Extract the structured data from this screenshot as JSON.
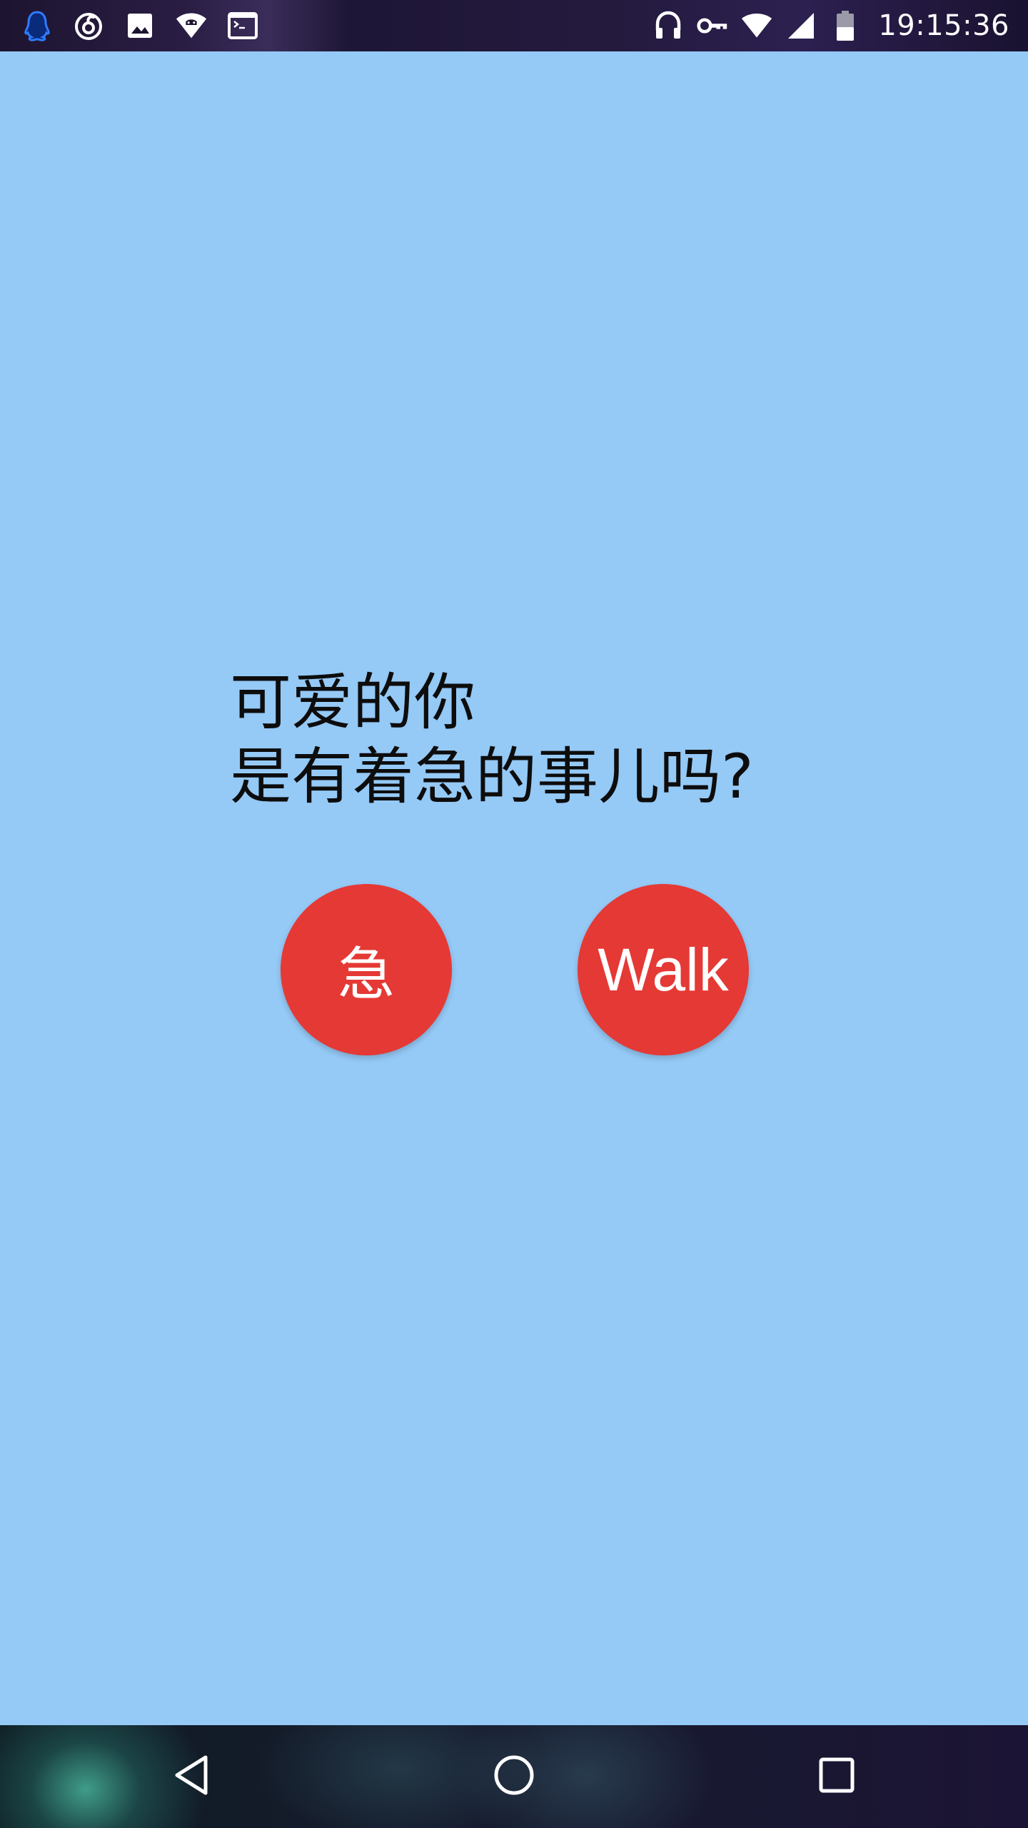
{
  "status_bar": {
    "time": "19:15:36",
    "left_icons": [
      "qq-penguin-icon",
      "netease-music-icon",
      "image-icon",
      "wifi-android-icon",
      "terminal-icon"
    ],
    "right_icons": [
      "headphones-icon",
      "vpn-key-icon",
      "wifi-icon",
      "cell-signal-icon",
      "battery-icon"
    ]
  },
  "main": {
    "prompt_line_1": "可爱的你",
    "prompt_line_2": "是有着急的事儿吗?",
    "buttons": [
      {
        "label": "急"
      },
      {
        "label": "Walk"
      }
    ]
  },
  "nav_bar": {
    "icons": [
      "back-icon",
      "home-icon",
      "recents-icon"
    ]
  },
  "colors": {
    "background": "#95c9f6",
    "button": "#e53935",
    "button_text": "#ffffff",
    "prompt_text": "#0d0d0d"
  }
}
